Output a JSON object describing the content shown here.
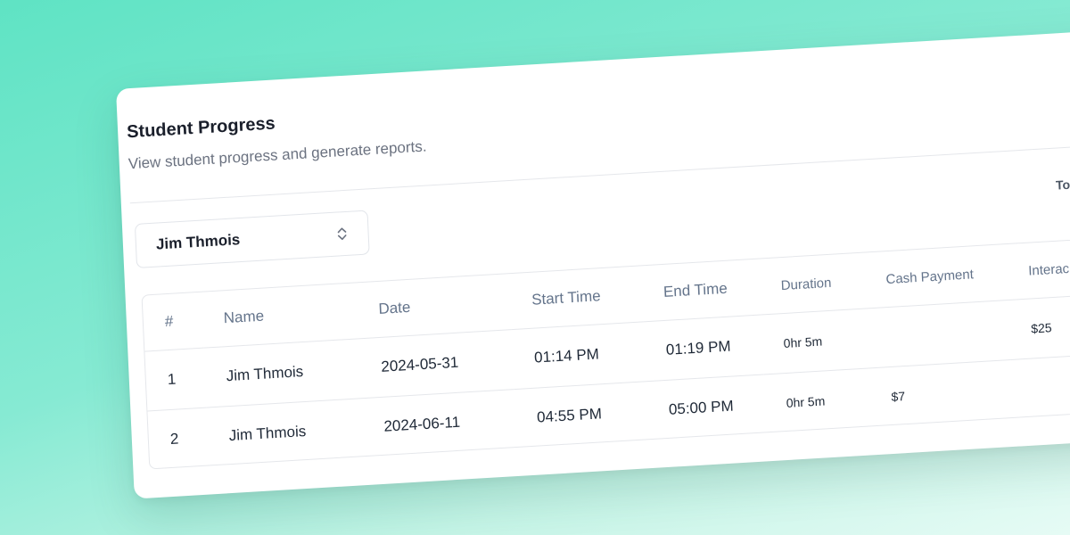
{
  "header": {
    "title": "Student Progress",
    "subtitle": "View student progress and generate reports."
  },
  "student_select": {
    "selected": "Jim Thmois"
  },
  "summary": {
    "total_label": "Tot"
  },
  "table": {
    "columns": [
      "#",
      "Name",
      "Date",
      "Start Time",
      "End Time",
      "Duration",
      "Cash Payment",
      "Interac P"
    ],
    "rows": [
      {
        "num": "1",
        "name": "Jim Thmois",
        "date": "2024-05-31",
        "start": "01:14 PM",
        "end": "01:19 PM",
        "duration": "0hr 5m",
        "cash": "",
        "interac": "$25"
      },
      {
        "num": "2",
        "name": "Jim Thmois",
        "date": "2024-06-11",
        "start": "04:55 PM",
        "end": "05:00 PM",
        "duration": "0hr 5m",
        "cash": "$7",
        "interac": ""
      }
    ]
  },
  "icons": {
    "select_chevrons": "chevrons-up-down-icon"
  },
  "colors": {
    "background_start": "#5fe3c4",
    "background_end": "#e6fbf5",
    "card": "#ffffff",
    "title": "#1a1f2b",
    "muted": "#6b7280"
  }
}
